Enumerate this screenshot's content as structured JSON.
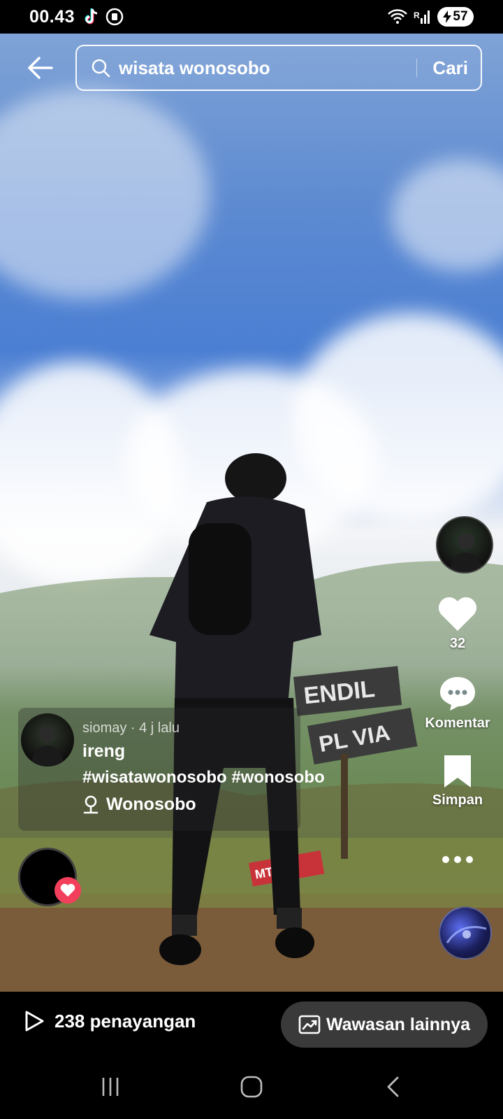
{
  "status_bar": {
    "time": "00.43",
    "battery": "57"
  },
  "search": {
    "query": "wisata wonosobo",
    "submit_label": "Cari"
  },
  "rail": {
    "like_count": "32",
    "comment_label": "Komentar",
    "save_label": "Simpan"
  },
  "post": {
    "author": "siomay",
    "time_ago": "4 j lalu",
    "meta": "siomay · 4 j lalu",
    "title": "ireng",
    "hashtags": "#wisatawonosobo #wonosobo",
    "location": "Wonosobo"
  },
  "scene": {
    "sign_top": "ENDIL",
    "sign_bottom": "PL VIA",
    "sign_red": "MT"
  },
  "stats": {
    "views": "238 penayangan",
    "insights_label": "Wawasan lainnya"
  },
  "colors": {
    "like_badge": "#f2405c",
    "insights_bg": "#3a3a3a"
  },
  "icons": {
    "back": "arrow-left-icon",
    "search": "search-icon",
    "like": "heart-icon",
    "comment": "comment-icon",
    "save": "bookmark-icon",
    "more": "more-icon",
    "location": "location-pin-icon",
    "play": "play-icon",
    "insights": "chart-trend-icon"
  }
}
